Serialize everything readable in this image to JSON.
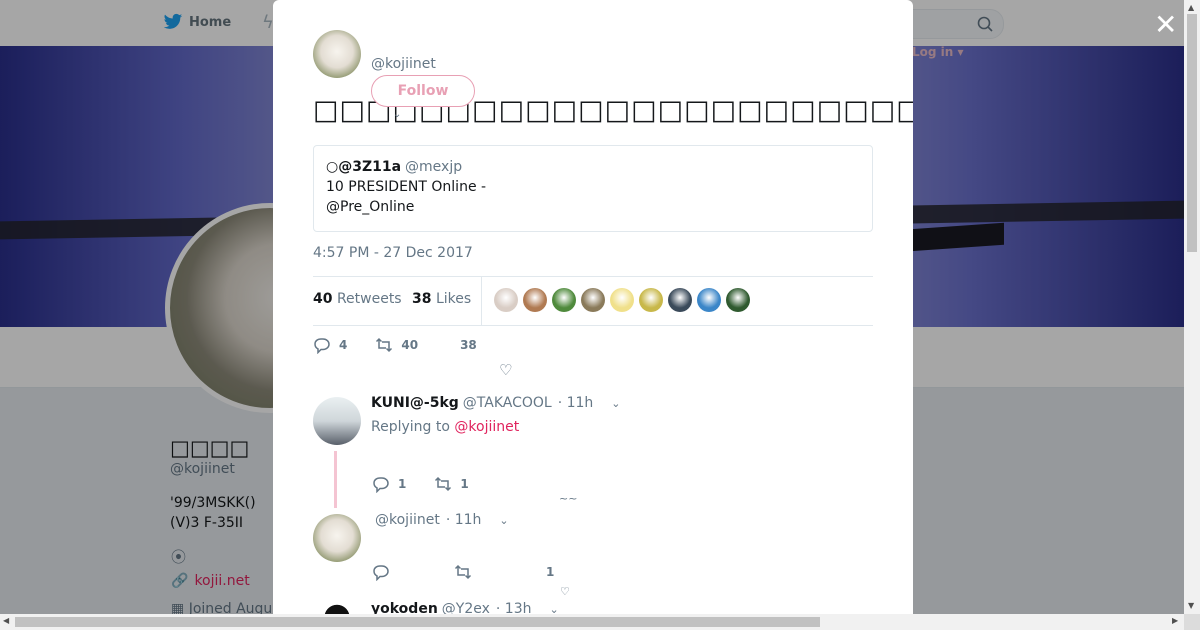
{
  "nav": {
    "home_label": "Home",
    "login_label": "Log in"
  },
  "profile": {
    "name": "□□□□",
    "handle": "@kojiinet",
    "bio_line1": "'99/3MSKK()",
    "bio_line2": "(V)3 F-35II",
    "website": "kojii.net",
    "joined": "Joined Augu"
  },
  "tweet": {
    "handle": "@kojiinet",
    "follow_label": "Follow",
    "text": "□□□□□□□□□□□□□□□□□□□□□□□□□□□□□□□□□□□□□□□□□□□□□□□□",
    "quote": {
      "name": "○@3Z11a",
      "handle": "@mexjp",
      "line1": "10 PRESIDENT Online -",
      "line2": "@Pre_Online"
    },
    "timestamp": "4:57 PM - 27 Dec 2017",
    "retweets_count": "40",
    "retweets_label": "Retweets",
    "likes_count": "38",
    "likes_label": "Likes",
    "reply_count": "4",
    "retweet_count": "40",
    "like_count": "38",
    "liker_colors": [
      "#d9cdc5",
      "#b07a52",
      "#4f8a3c",
      "#8a7a5a",
      "#f0e08a",
      "#c8b84a",
      "#3a4a5a",
      "#3b86c8",
      "#2f5a2f"
    ]
  },
  "replies": [
    {
      "name": "KUNI@-5kg",
      "handle": "@TAKACOOL",
      "time": "· 11h",
      "replying_prefix": "Replying to",
      "replying_to": "@kojiinet",
      "reply_count": "1",
      "retweet_count": "1",
      "extra": "~~"
    },
    {
      "name": "",
      "handle": "@kojiinet",
      "time": "· 11h",
      "like_count": "1"
    },
    {
      "name": "yokoden",
      "handle": "@Y2ex",
      "time": "· 13h"
    }
  ],
  "colors": {
    "accent": "#e0245e",
    "follow_border": "#e8a0b4",
    "thread_line": "#f4c4d2"
  }
}
